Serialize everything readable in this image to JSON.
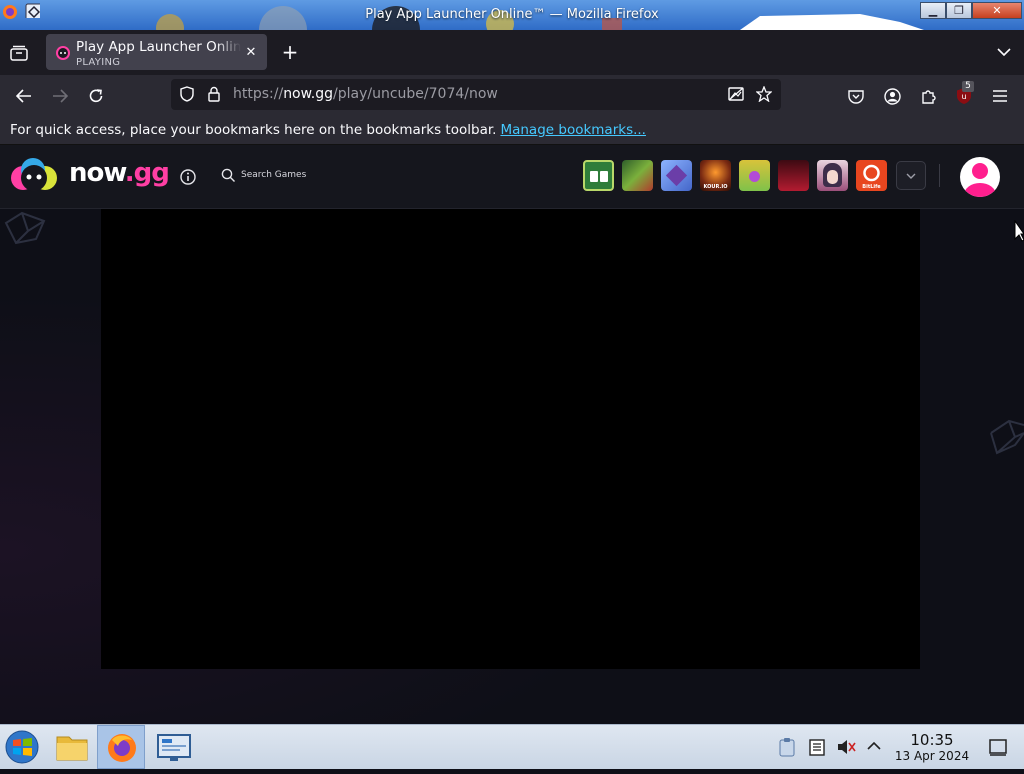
{
  "window": {
    "title": "Play App Launcher Online™ — Mozilla Firefox"
  },
  "tab": {
    "title": "Play App Launcher Online™",
    "subtitle": "PLAYING"
  },
  "address_bar": {
    "url_prefix": "https://",
    "url_host": "now.gg",
    "url_path": "/play/uncube/7074/now"
  },
  "extensions": {
    "badge_count": "5"
  },
  "bookmarks_bar": {
    "message": "For quick access, place your bookmarks here on the bookmarks toolbar.",
    "link": "Manage bookmarks..."
  },
  "site": {
    "logo_now": "now",
    "logo_dot": ".",
    "logo_gg": "gg",
    "search_placeholder": "Search Games",
    "games": [
      {
        "label": "",
        "color": "#2f7d3a"
      },
      {
        "label": "",
        "color": "#3c6c2a"
      },
      {
        "label": "",
        "color": "#5a7fd1"
      },
      {
        "label": "KOUR.IO",
        "color": "#7a2a12"
      },
      {
        "label": "",
        "color": "#d8c33a"
      },
      {
        "label": "",
        "color": "#b31b30"
      },
      {
        "label": "",
        "color": "#3d2d4a"
      },
      {
        "label": "BitLife",
        "color": "#e8461f"
      }
    ]
  },
  "taskbar": {
    "time": "10:35",
    "date": "13 Apr 2024"
  },
  "colors": {
    "accent_pink": "#ff3fa4",
    "link_blue": "#45c9ff",
    "page_bg": "#0e0f17"
  }
}
